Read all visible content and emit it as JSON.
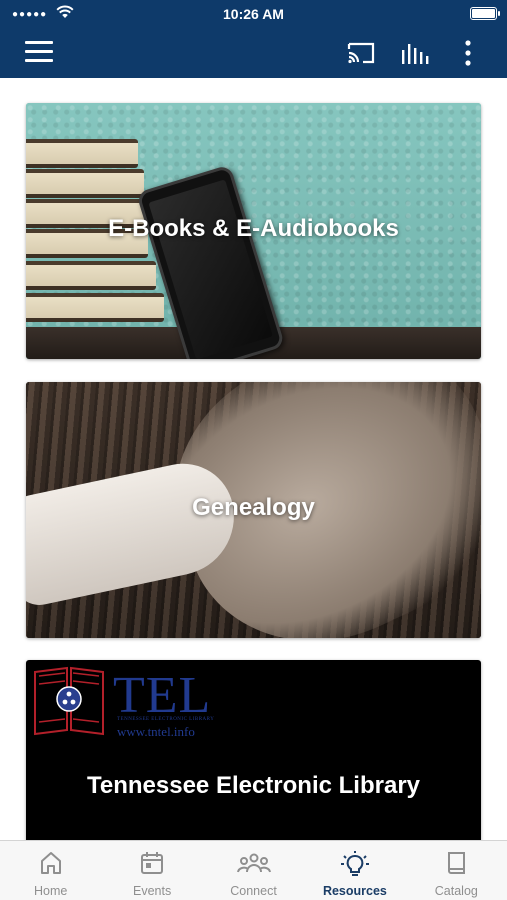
{
  "status_bar": {
    "signal": "●●●●●",
    "time": "10:26 AM"
  },
  "app_bar": {
    "menu_icon": "hamburger-menu-icon",
    "actions": [
      "cast-icon",
      "audio-bars-icon",
      "more-vertical-icon"
    ],
    "color": "#0e3a6a"
  },
  "cards": [
    {
      "title": "E-Books & E-Audiobooks"
    },
    {
      "title": "Genealogy"
    },
    {
      "title": "Tennessee Electronic Library",
      "logo": {
        "abbrev": "TEL",
        "subtitle": "TENNESSEE ELECTRONIC LIBRARY",
        "url": "www.tntel.info"
      }
    }
  ],
  "tabbar": {
    "active": "Resources",
    "active_color": "#1b3d66",
    "tabs": [
      {
        "label": "Home",
        "icon": "home-icon"
      },
      {
        "label": "Events",
        "icon": "calendar-icon"
      },
      {
        "label": "Connect",
        "icon": "people-icon"
      },
      {
        "label": "Resources",
        "icon": "lightbulb-icon"
      },
      {
        "label": "Catalog",
        "icon": "book-icon"
      }
    ]
  }
}
